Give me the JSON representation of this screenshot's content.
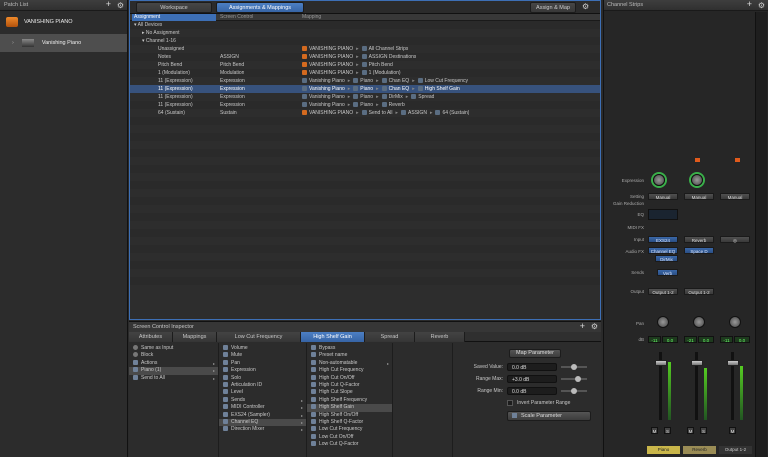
{
  "patch_list": {
    "title": "Patch List",
    "items": [
      {
        "label": "VANISHING PIANO",
        "type": "folder"
      },
      {
        "label": "Vanishing Piano",
        "type": "patch"
      }
    ]
  },
  "center": {
    "tabs": [
      "Workspace",
      "Assignments & Mappings"
    ],
    "assign_map_label": "Assign & Map",
    "columns": [
      "Assignment",
      "Screen Control",
      "Mapping"
    ],
    "tree": [
      {
        "indent": 0,
        "label": "All Devices"
      },
      {
        "indent": 1,
        "label": "No Assignment"
      },
      {
        "indent": 1,
        "label": "Channel 1-16"
      }
    ],
    "rows": [
      {
        "assignment": "Unassigned",
        "control": "",
        "map1": "VANISHING PIANO",
        "map2": "All Channel Strips",
        "map3": "",
        "map4": "",
        "sel": false
      },
      {
        "assignment": "Notes",
        "control": "ASSIGN",
        "map1": "VANISHING PIANO",
        "map2": "ASSIGN Destinations",
        "map3": "",
        "map4": "",
        "sel": false
      },
      {
        "assignment": "Pitch Bend",
        "control": "Pitch Bend",
        "map1": "VANISHING PIANO",
        "map2": "Pitch Bend",
        "map3": "",
        "map4": "",
        "sel": false
      },
      {
        "assignment": "1 (Modulation)",
        "control": "Modulation",
        "map1": "VANISHING PIANO",
        "map2": "1 (Modulation)",
        "map3": "",
        "map4": "",
        "sel": false
      },
      {
        "assignment": "11 (Expression)",
        "control": "Expression",
        "map1": "Vanishing Piano",
        "map2": "Piano",
        "map3": "Chan EQ",
        "map4": "Low Cut Frequency",
        "sel": false
      },
      {
        "assignment": "11 (Expression)",
        "control": "Expression",
        "map1": "Vanishing Piano",
        "map2": "Piano",
        "map3": "Chan EQ",
        "map4": "High Shelf Gain",
        "sel": true
      },
      {
        "assignment": "11 (Expression)",
        "control": "Expression",
        "map1": "Vanishing Piano",
        "map2": "Piano",
        "map3": "DirMix",
        "map4": "Spread",
        "sel": false
      },
      {
        "assignment": "11 (Expression)",
        "control": "Expression",
        "map1": "Vanishing Piano",
        "map2": "Piano",
        "map3": "Reverb",
        "map4": "",
        "sel": false
      },
      {
        "assignment": "64 (Sustain)",
        "control": "Sustain",
        "map1": "VANISHING PIANO",
        "map2": "Send to All",
        "map3": "ASSIGN",
        "map4": "64 (Sustain)",
        "sel": false
      }
    ]
  },
  "inspector": {
    "title": "Screen Control Inspector",
    "tabs": [
      "Attributes",
      "Mappings",
      "Low Cut Frequency",
      "High Shelf Gain",
      "Spread",
      "Reverb"
    ],
    "col1": [
      "Same as Input",
      "Block",
      "Actions",
      "Piano (1)",
      "Send to All"
    ],
    "col2": [
      "Volume",
      "Mute",
      "Pan",
      "Expression",
      "Solo",
      "Articulation ID",
      "Level",
      "Sends",
      "MIDI Controller",
      "EXS24 (Sampler)",
      "Channel EQ",
      "Direction Mixer"
    ],
    "col3": [
      "Bypass",
      "Preset name",
      "Non-automatable",
      "High Cut Frequency",
      "High Cut On/Off",
      "High Cut Q-Factor",
      "High Cut Slope",
      "High Shelf Frequency",
      "High Shelf Gain",
      "High Shelf On/Off",
      "High Shelf Q-Factor",
      "Low Cut Frequency",
      "Low Cut On/Off",
      "Low Cut Q-Factor"
    ],
    "map_param_label": "Map Parameter",
    "saved_value_label": "Saved Value:",
    "saved_value": "0.0 dB",
    "range_max_label": "Range Max:",
    "range_max": "+3.0 dB",
    "range_min_label": "Range Min:",
    "range_min": "0.0 dB",
    "invert_label": "Invert Parameter Range",
    "scale_label": "Scale Parameter"
  },
  "strips": {
    "title": "Channel Strips",
    "labels": {
      "expression": "Expression",
      "setting": "Setting",
      "gain_reduction": "Gain Reduction",
      "eq": "EQ",
      "midi_fx": "MIDI FX",
      "input": "Input",
      "audio_fx": "Audio FX",
      "sends": "Sends",
      "output": "Output",
      "pan": "Pan",
      "db": "dB"
    },
    "manual": "Manual",
    "input1": "EXS24",
    "input2": "Reverb",
    "fx1": "Channel EQ",
    "fx2": "DirMix",
    "fx3": "Space D",
    "send": "Verb",
    "out1": "Output 1-2",
    "out2": "Output 1-2",
    "s1_vals": [
      "-11",
      "0.0"
    ],
    "s2_vals": [
      "-21",
      "0.0"
    ],
    "s3_vals": [
      "-11",
      "0.0"
    ],
    "m": "M",
    "s": "S",
    "names": [
      "Piano",
      "Reverb",
      "Output 1-2"
    ],
    "colors": {
      "piano": "#c9b64a",
      "reverb": "#9a8c55"
    }
  }
}
